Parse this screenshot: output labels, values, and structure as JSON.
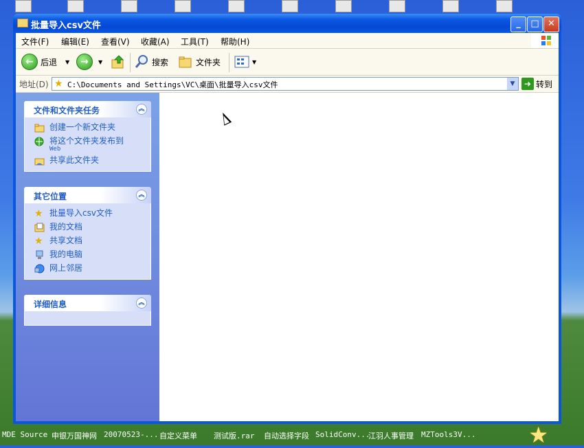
{
  "window": {
    "title": "批量导入csv文件",
    "controls": {
      "minimize": "_",
      "maximize": "□",
      "close": "✕"
    }
  },
  "menu": [
    "文件(F)",
    "编辑(E)",
    "查看(V)",
    "收藏(A)",
    "工具(T)",
    "帮助(H)"
  ],
  "toolbar": {
    "back": "后退",
    "search": "搜索",
    "folders": "文件夹"
  },
  "address": {
    "label": "地址(D)",
    "path": "C:\\Documents and Settings\\VC\\桌面\\批量导入csv文件",
    "go": "转到"
  },
  "tasks_panel": {
    "title": "文件和文件夹任务",
    "items": [
      {
        "label": "创建一个新文件夹",
        "icon": "new-folder-icon"
      },
      {
        "label": "将这个文件夹发布到",
        "sub": "Web",
        "icon": "publish-web-icon"
      },
      {
        "label": "共享此文件夹",
        "icon": "share-folder-icon"
      }
    ]
  },
  "places_panel": {
    "title": "其它位置",
    "items": [
      {
        "label": "批量导入csv文件",
        "icon": "star-folder-icon"
      },
      {
        "label": "我的文档",
        "icon": "my-documents-icon"
      },
      {
        "label": "共享文档",
        "icon": "shared-docs-icon"
      },
      {
        "label": "我的电脑",
        "icon": "my-computer-icon"
      },
      {
        "label": "网上邻居",
        "icon": "network-icon"
      }
    ]
  },
  "details_panel": {
    "title": "详细信息"
  },
  "taskbar": [
    "MDE Source",
    "申银万国神网",
    "20070523-...",
    "自定义菜单",
    "测试版.rar",
    "自动选择字段",
    "SolidConv...",
    "江羽人事管理",
    "MZTools3V..."
  ],
  "colors": {
    "titlebar": "#0a58e3",
    "link": "#215dc6",
    "panel_body": "#d6dff7"
  }
}
